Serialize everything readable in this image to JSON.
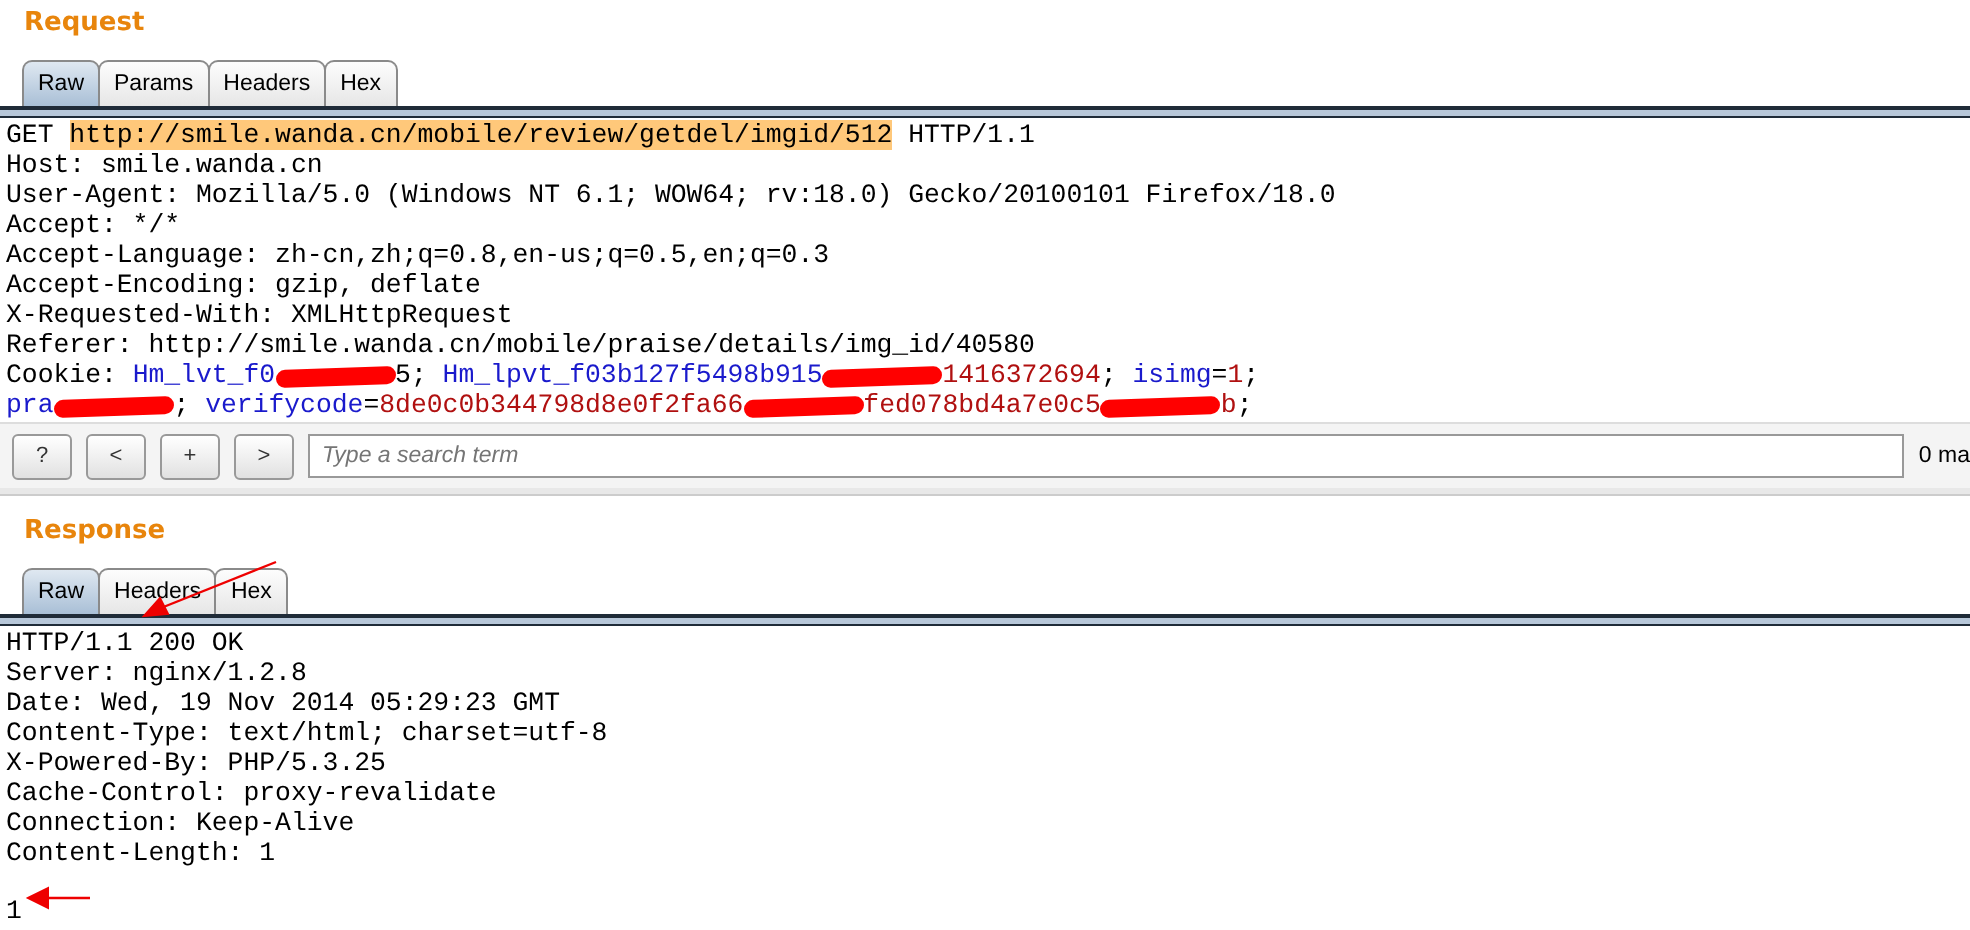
{
  "request": {
    "title": "Request",
    "tabs": [
      {
        "label": "Raw",
        "selected": true
      },
      {
        "label": "Params",
        "selected": false
      },
      {
        "label": "Headers",
        "selected": false
      },
      {
        "label": "Hex",
        "selected": false
      }
    ],
    "lines": [
      [
        {
          "kind": "plain",
          "text": "GET "
        },
        {
          "kind": "highlight",
          "text": "http://smile.wanda.cn/mobile/review/getdel/imgid/512"
        },
        {
          "kind": "plain",
          "text": " HTTP/1.1"
        }
      ],
      [
        {
          "kind": "plain",
          "text": "Host: smile.wanda.cn"
        }
      ],
      [
        {
          "kind": "plain",
          "text": "User-Agent: Mozilla/5.0 (Windows NT 6.1; WOW64; rv:18.0) Gecko/20100101 Firefox/18.0"
        }
      ],
      [
        {
          "kind": "plain",
          "text": "Accept: */*"
        }
      ],
      [
        {
          "kind": "plain",
          "text": "Accept-Language: zh-cn,zh;q=0.8,en-us;q=0.5,en;q=0.3"
        }
      ],
      [
        {
          "kind": "plain",
          "text": "Accept-Encoding: gzip, deflate"
        }
      ],
      [
        {
          "kind": "plain",
          "text": "X-Requested-With: XMLHttpRequest"
        }
      ],
      [
        {
          "kind": "plain",
          "text": "Referer: http://smile.wanda.cn/mobile/praise/details/img_id/40580"
        }
      ],
      [
        {
          "kind": "plain",
          "text": "Cookie: "
        },
        {
          "kind": "name",
          "text": "Hm_lvt_f0"
        },
        {
          "kind": "redacted"
        },
        {
          "kind": "plain",
          "text": "5; "
        },
        {
          "kind": "name",
          "text": "Hm_lpvt_f03b127f5498b915"
        },
        {
          "kind": "redacted"
        },
        {
          "kind": "value",
          "text": "1416372694"
        },
        {
          "kind": "plain",
          "text": "; "
        },
        {
          "kind": "name",
          "text": "isimg"
        },
        {
          "kind": "plain",
          "text": "="
        },
        {
          "kind": "value",
          "text": "1"
        },
        {
          "kind": "plain",
          "text": ";"
        }
      ],
      [
        {
          "kind": "name",
          "text": "pra"
        },
        {
          "kind": "redacted"
        },
        {
          "kind": "plain",
          "text": "; "
        },
        {
          "kind": "name",
          "text": "verifycode"
        },
        {
          "kind": "plain",
          "text": "="
        },
        {
          "kind": "value",
          "text": "8de0c0b344798d8e0f2fa66"
        },
        {
          "kind": "redacted"
        },
        {
          "kind": "value",
          "text": "fed078bd4a7e0c5"
        },
        {
          "kind": "redacted"
        },
        {
          "kind": "value",
          "text": "b"
        },
        {
          "kind": "plain",
          "text": ";"
        }
      ]
    ],
    "toolbar": {
      "buttons": [
        "?",
        "<",
        "+",
        ">"
      ],
      "search": {
        "placeholder": "Type a search term"
      },
      "matches": "0 ma"
    }
  },
  "response": {
    "title": "Response",
    "tabs": [
      {
        "label": "Raw",
        "selected": true
      },
      {
        "label": "Headers",
        "selected": false
      },
      {
        "label": "Hex",
        "selected": false
      }
    ],
    "lines": [
      "HTTP/1.1 200 OK",
      "Server: nginx/1.2.8",
      "Date: Wed, 19 Nov 2014 05:29:23 GMT",
      "Content-Type: text/html; charset=utf-8",
      "X-Powered-By: PHP/5.3.25",
      "Cache-Control: proxy-revalidate",
      "Connection: Keep-Alive",
      "Content-Length: 1"
    ],
    "body": "1"
  }
}
